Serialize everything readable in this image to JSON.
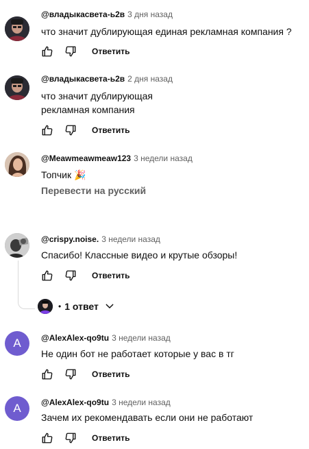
{
  "reply_label": "Ответить",
  "comments": [
    {
      "author": "@владыкасвета-ь2в",
      "time": "3 дня назад",
      "text": "что значит дублирующая  единая рекламная компания ?"
    },
    {
      "author": "@владыкасвета-ь2в",
      "time": "2 дня назад",
      "text_line1": "что значит дублирующая",
      "text_line2": "рекламная компания"
    },
    {
      "author": "@Meawmeawmeaw123",
      "time": "3 недели назад",
      "text": "Топчик 🎉",
      "translate_label": "Перевести на русский"
    },
    {
      "author": "@crispy.noise.",
      "time": "3 недели назад",
      "text": "Спасибо! Классные видео и крутые обзоры!",
      "replies_dot": "•",
      "replies_label": "1 ответ"
    },
    {
      "author": "@AlexAlex-qo9tu",
      "time": "3 недели назад",
      "text": "Не один бот не работает которые у вас  в тг",
      "avatar_letter": "A"
    },
    {
      "author": "@AlexAlex-qo9tu",
      "time": "3 недели назад",
      "text": "Зачем их рекомендавать если они не работают",
      "avatar_letter": "A"
    }
  ],
  "colors": {
    "avatar_letter_bg": "#6f5ccf",
    "meta_gray": "#606060",
    "text": "#0f0f0f"
  },
  "icons": [
    "thumb-up-icon",
    "thumb-down-icon",
    "chevron-down-icon"
  ]
}
